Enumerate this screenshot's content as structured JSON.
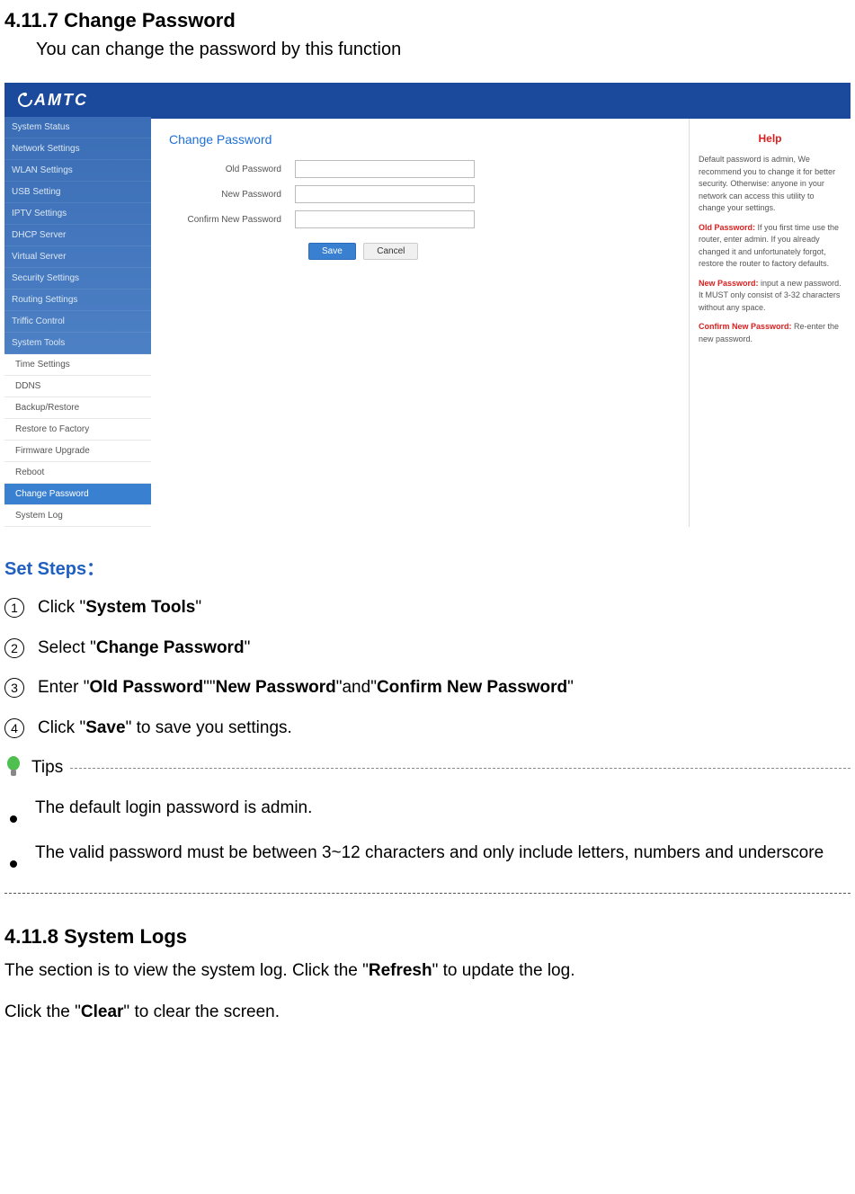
{
  "section1": {
    "heading": "4.11.7 Change Password",
    "intro": "You can change the password by this function"
  },
  "router": {
    "logo": "AMTC",
    "sidebar": {
      "items": [
        "System Status",
        "Network Settings",
        "WLAN Settings",
        "USB Setting",
        "IPTV Settings",
        "DHCP Server",
        "Virtual Server",
        "Security Settings",
        "Routing Settings",
        "Triffic Control",
        "System Tools"
      ],
      "sub": [
        "Time Settings",
        "DDNS",
        "Backup/Restore",
        "Restore to Factory",
        "Firmware Upgrade",
        "Reboot",
        "Change Password",
        "System Log"
      ]
    },
    "form": {
      "title": "Change Password",
      "old_label": "Old Password",
      "new_label": "New Password",
      "confirm_label": "Confirm New Password",
      "save": "Save",
      "cancel": "Cancel"
    },
    "help": {
      "title": "Help",
      "p1": "Default password is admin, We recommend you to change it for better security. Otherwise: anyone in your network can access this utility to change your settings.",
      "old_label": "Old Password:",
      "old_text": " If you first time use the router, enter admin. If you already changed it and unfortunately forgot, restore the router to factory defaults.",
      "new_label": "New Password:",
      "new_text": " input a new password. It MUST only consist of 3-32 characters without any space.",
      "confirm_label": "Confirm New Password:",
      "confirm_text": " Re-enter the new password."
    }
  },
  "steps": {
    "heading": "Set Steps：",
    "s1_pre": "Click \"",
    "s1_bold": "System Tools",
    "s1_post": "\"",
    "s2_pre": "Select \"",
    "s2_bold": "Change Password",
    "s2_post": "\"",
    "s3_pre": "Enter \"",
    "s3_b1": "Old Password",
    "s3_mid1": "\"\"",
    "s3_b2": "New Password",
    "s3_mid2": "\"and\"",
    "s3_b3": "Confirm New Password",
    "s3_post": "\"",
    "s4_pre": "Click \"",
    "s4_bold": "Save",
    "s4_post": "\" to save you settings."
  },
  "tips": {
    "label": "Tips",
    "b1": "The default login password is admin.",
    "b2": "The valid password must be between 3~12 characters and only include letters, numbers and underscore"
  },
  "section2": {
    "heading": "4.11.8 System Logs",
    "p1_pre": "The section is to view the system log. Click the \"",
    "p1_bold": "Refresh",
    "p1_post": "\" to update the log.",
    "p2_pre": "Click the \"",
    "p2_bold": "Clear",
    "p2_post": "\" to clear the screen."
  }
}
